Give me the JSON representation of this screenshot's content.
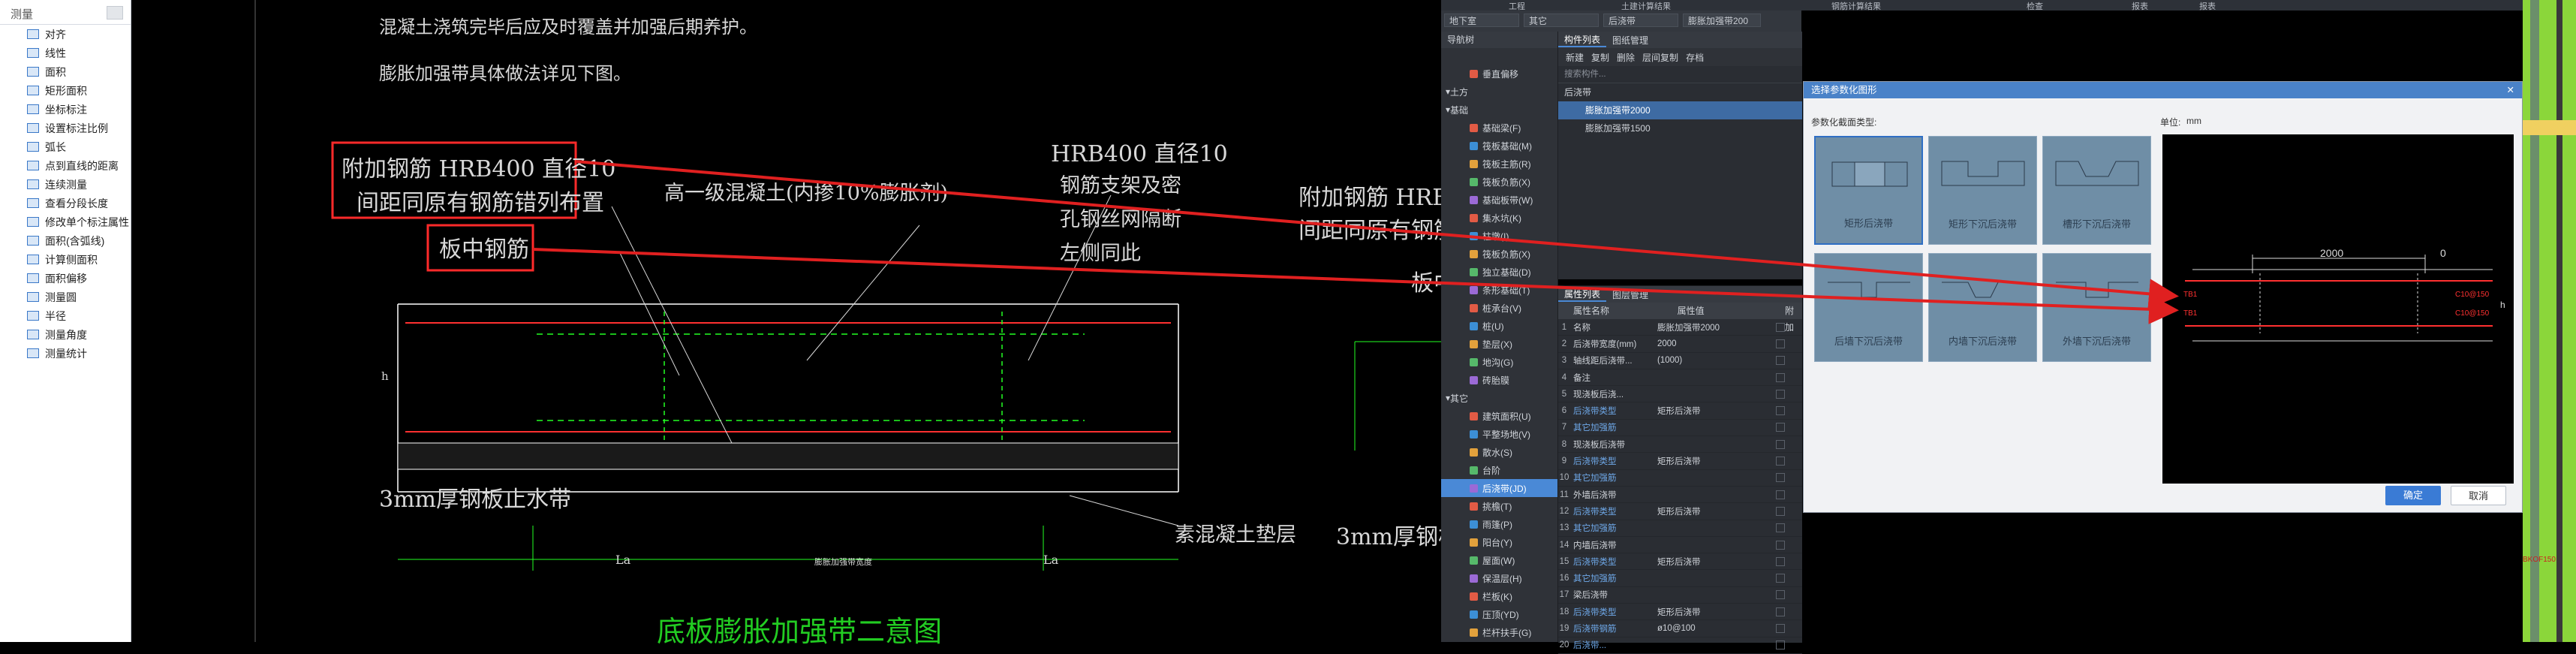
{
  "measure_panel": {
    "title": "测量",
    "items": [
      "对齐",
      "线性",
      "面积",
      "矩形面积",
      "坐标标注",
      "设置标注比例",
      "弧长",
      "点到直线的距离",
      "连续测量",
      "查看分段长度",
      "修改单个标注属性",
      "面积(含弧线)",
      "计算侧面积",
      "面积偏移",
      "测量圆",
      "半径",
      "测量角度",
      "测量统计"
    ]
  },
  "cad": {
    "top_line1": "混凝土浇筑完毕后应及时覆盖并加强后期养护。",
    "top_line2": "膨胀加强带具体做法详见下图。",
    "callout1_l1": "附加钢筋 HRB400 直径10",
    "callout1_l2": "间距同原有钢筋错列布置",
    "callout2": "板中钢筋",
    "concrete": "高一级混凝土(内掺10%膨胀剂)",
    "hrb_l1": "HRB400 直径10",
    "hrb_l2": "钢筋支架及密",
    "hrb_l3": "孔钢丝网隔断",
    "hrb_l4": "左侧同此",
    "steel_plate": "3mm厚钢板止水带",
    "cushion": "素混凝土垫层",
    "bottom_title": "底板膨胀加强带二意图",
    "la_left": "La",
    "la_right": "La",
    "dim_label": "膨胀加强带宽度",
    "h_label": "h",
    "right_callout1": "附加钢筋 HRB4",
    "right_callout2": "间距同原有钢筋",
    "right_callout3": "板中",
    "right_steel": "3mm厚钢板"
  },
  "top_tabs": [
    "工程",
    "土建计算结果",
    "钢筋计算结果",
    "检查",
    "报表",
    "报表"
  ],
  "filter_bar": {
    "floor": "地下室",
    "category": "其它",
    "type": "后浇带",
    "name": "膨胀加强带200"
  },
  "nav": {
    "title": "导航树",
    "groups": [
      {
        "label": "土方"
      },
      {
        "label": "基础"
      },
      {
        "label": "其它"
      }
    ],
    "items_top": [
      "垂直偏移"
    ],
    "items_foundation": [
      "基础梁(F)",
      "筏板基础(M)",
      "筏板主筋(R)",
      "筏板负筋(X)",
      "基础板带(W)",
      "集水坑(K)",
      "柱墩(I)",
      "筏板负筋(X)",
      "独立基础(D)",
      "条形基础(T)",
      "桩承台(V)",
      "桩(U)",
      "垫层(X)",
      "地沟(G)",
      "砖胎膜"
    ],
    "items_other": [
      "建筑面积(U)",
      "平整场地(V)",
      "散水(S)",
      "台阶",
      "后浇带(JD)",
      "挑檐(T)",
      "雨篷(P)",
      "阳台(Y)",
      "屋面(W)",
      "保温层(H)",
      "栏板(K)",
      "压顶(YD)",
      "栏杆扶手(G)"
    ]
  },
  "component_list": {
    "tabs": [
      "构件列表",
      "图纸管理"
    ],
    "toolbar": [
      "新建",
      "复制",
      "删除",
      "层间复制",
      "存档"
    ],
    "search_placeholder": "搜索构件...",
    "root": "后浇带",
    "children": [
      "膨胀加强带2000",
      "膨胀加强带1500"
    ]
  },
  "property_list": {
    "tabs": [
      "属性列表",
      "图层管理"
    ],
    "headers": [
      "属性名称",
      "属性值",
      "附加"
    ],
    "rows": [
      {
        "n": "1",
        "k": "名称",
        "v": "膨胀加强带2000"
      },
      {
        "n": "2",
        "k": "后浇带宽度(mm)",
        "v": "2000"
      },
      {
        "n": "3",
        "k": "轴线距后浇带...",
        "v": "(1000)"
      },
      {
        "n": "4",
        "k": "备注",
        "v": ""
      },
      {
        "n": "5",
        "k": "现浇板后浇...",
        "v": ""
      },
      {
        "n": "6",
        "k": "后浇带类型",
        "v": "矩形后浇带"
      },
      {
        "n": "7",
        "k": "其它加强筋",
        "v": ""
      },
      {
        "n": "8",
        "k": "现浇板后浇带",
        "v": ""
      },
      {
        "n": "9",
        "k": "后浇带类型",
        "v": "矩形后浇带"
      },
      {
        "n": "10",
        "k": "其它加强筋",
        "v": ""
      },
      {
        "n": "11",
        "k": "外墙后浇带",
        "v": ""
      },
      {
        "n": "12",
        "k": "后浇带类型",
        "v": "矩形后浇带"
      },
      {
        "n": "13",
        "k": "其它加强筋",
        "v": ""
      },
      {
        "n": "14",
        "k": "内墙后浇带",
        "v": ""
      },
      {
        "n": "15",
        "k": "后浇带类型",
        "v": "矩形后浇带"
      },
      {
        "n": "16",
        "k": "其它加强筋",
        "v": ""
      },
      {
        "n": "17",
        "k": "梁后浇带",
        "v": ""
      },
      {
        "n": "18",
        "k": "后浇带类型",
        "v": "矩形后浇带"
      },
      {
        "n": "19",
        "k": "后浇带钢筋",
        "v": "ø10@100"
      },
      {
        "n": "20",
        "k": "后浇带...",
        "v": ""
      }
    ]
  },
  "dialog": {
    "title": "选择参数化图形",
    "type_label": "参数化截面类型:",
    "unit_label": "单位:",
    "unit_value": "mm",
    "tiles": [
      "矩形后浇带",
      "矩形下沉后浇带",
      "槽形下沉后浇带",
      "后墙下沉后浇带",
      "内墙下沉后浇带",
      "外墙下沉后浇带"
    ],
    "preview": {
      "dim_total": "2000",
      "dim_zero": "0",
      "rebar_left1": "TB1",
      "rebar_left2": "TB1",
      "rebar_right1": "C10@150",
      "rebar_right2": "C10@150",
      "h": "h"
    },
    "ok": "确定",
    "cancel": "取消"
  },
  "plan": {
    "label": "BKOF150"
  },
  "colors": {
    "accent": "#4a82c8",
    "arrow": "#e02020",
    "highlight": "#ff2a2a",
    "plan_green": "#8bd63a"
  }
}
